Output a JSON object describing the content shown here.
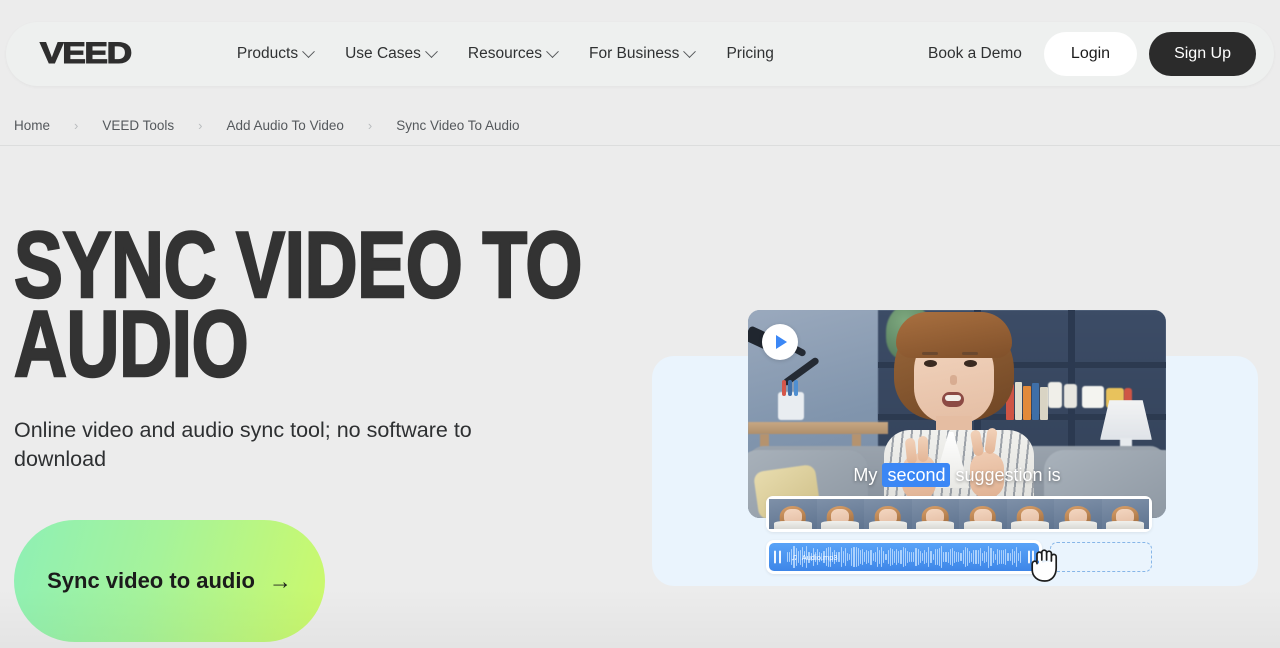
{
  "nav": {
    "logo": "VEED",
    "links": [
      {
        "label": "Products",
        "has_chevron": true
      },
      {
        "label": "Use Cases",
        "has_chevron": true
      },
      {
        "label": "Resources",
        "has_chevron": true
      },
      {
        "label": "For Business",
        "has_chevron": true
      },
      {
        "label": "Pricing",
        "has_chevron": false
      }
    ],
    "book_demo": "Book a Demo",
    "login": "Login",
    "signup": "Sign Up",
    "signup_bg": "#2b2b2b",
    "login_bg": "#ffffff"
  },
  "breadcrumb": {
    "separator": "›",
    "items": [
      "Home",
      "VEED Tools",
      "Add Audio To Video",
      "Sync Video To Audio"
    ]
  },
  "hero": {
    "headline_line1": "Sync Video To",
    "headline_line2": "Audio",
    "subhead": "Online video and audio sync tool; no software to download",
    "cta_label": "Sync video to audio",
    "cta_arrow": "→",
    "cta_gradient_from": "#8ef0b5",
    "cta_gradient_to": "#cdf96a"
  },
  "preview": {
    "backdrop_color": "#eaf4fd",
    "play_button": "play-icon",
    "caption_before": "My",
    "caption_highlight": "second",
    "caption_after": "suggestion is",
    "caption_highlight_color": "#3b87f5",
    "filmstrip_frames": 8,
    "audio": {
      "file_name": "Audio.mp3",
      "note_icon": "♫",
      "clip_color": "#3e86e8",
      "empty_track_border": "#87b6e8"
    },
    "cursor": "grab-hand-cursor"
  }
}
